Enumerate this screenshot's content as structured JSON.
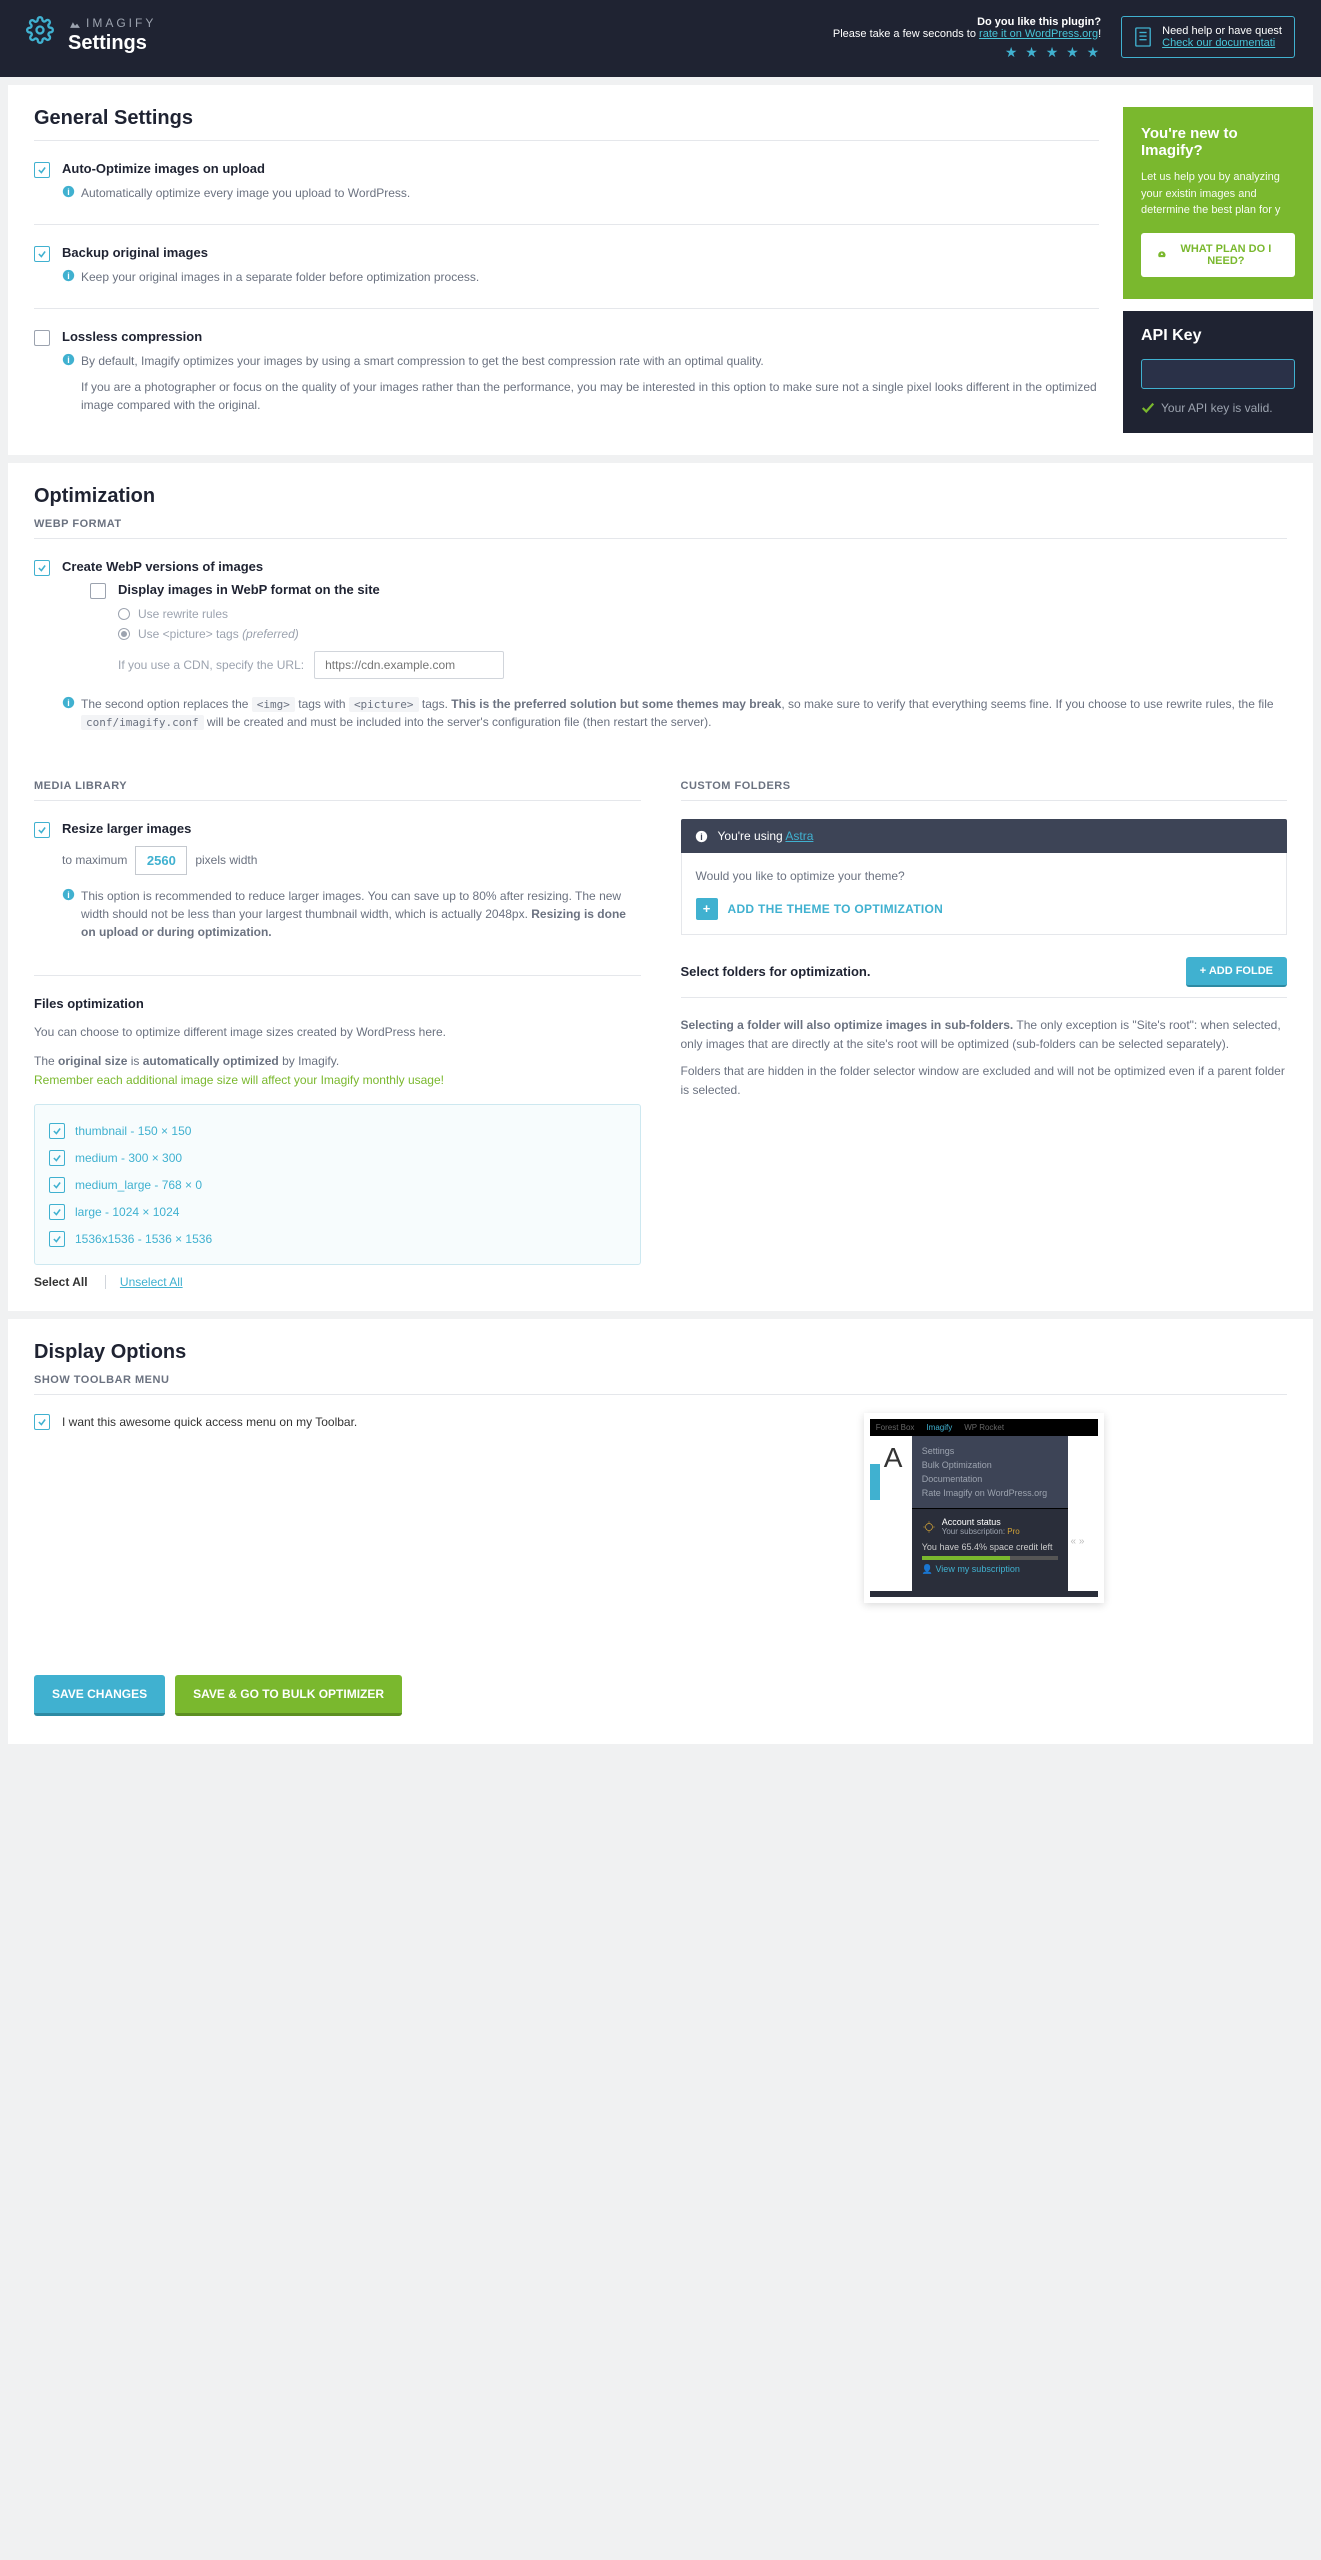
{
  "header": {
    "brand": "IMAGIFY",
    "title": "Settings",
    "rate_q": "Do you like this plugin?",
    "rate_pre": "Please take a few seconds to ",
    "rate_link": "rate it on WordPress.org",
    "help_q": "Need help or have quest",
    "help_link": "Check our documentati"
  },
  "general": {
    "heading": "General Settings",
    "auto": {
      "label": "Auto-Optimize images on upload",
      "desc": "Automatically optimize every image you upload to WordPress."
    },
    "backup": {
      "label": "Backup original images",
      "desc": "Keep your original images in a separate folder before optimization process."
    },
    "lossless": {
      "label": "Lossless compression",
      "desc1": "By default, Imagify optimizes your images by using a smart compression to get the best compression rate with an optimal quality.",
      "desc2": "If you are a photographer or focus on the quality of your images rather than the performance, you may be interested in this option to make sure not a single pixel looks different in the optimized image compared with the original."
    }
  },
  "promo": {
    "title": "You're new to Imagify?",
    "body": "Let us help you by analyzing your existin images and determine the best plan for y",
    "btn": "WHAT PLAN DO I NEED?"
  },
  "api": {
    "title": "API Key",
    "valid": "Your API key is valid."
  },
  "opt": {
    "heading": "Optimization",
    "sub_webp": "WEBP FORMAT",
    "create_webp": "Create WebP versions of images",
    "display_webp": "Display images in WebP format on the site",
    "r1": "Use rewrite rules",
    "r2_a": "Use <picture> tags ",
    "r2_b": "(preferred)",
    "cdn_label": "If you use a CDN, specify the URL:",
    "cdn_ph": "https://cdn.example.com",
    "note1a": "The second option replaces the ",
    "note1b": " tags with ",
    "note1c": " tags. ",
    "note1d": "This is the preferred solution but some themes may break",
    "note1e": ", so make sure to verify that everything seems fine. If you choose to use rewrite rules, the file ",
    "note1f": " will be created and must be included into the server's configuration file (then restart the server).",
    "code_img": "<img>",
    "code_pic": "<picture>",
    "code_conf": "conf/imagify.conf",
    "sub_media": "MEDIA LIBRARY",
    "sub_custom": "CUSTOM FOLDERS",
    "resize_label": "Resize larger images",
    "resize_to": "to maximum",
    "resize_val": "2560",
    "resize_px": "pixels width",
    "resize_note_a": "This option is recommended to reduce larger images. You can save up to 80% after resizing. The new width should not be less than your largest thumbnail width, which is actually 2048px. ",
    "resize_note_b": "Resizing is done on upload or during optimization.",
    "files_head": "Files optimization",
    "files_p1": "You can choose to optimize different image sizes created by WordPress here.",
    "files_p2a": "The ",
    "files_p2b": "original size",
    "files_p2c": " is ",
    "files_p2d": "automatically optimized",
    "files_p2e": " by Imagify.",
    "files_p3": "Remember each additional image size will affect your Imagify monthly usage!",
    "sizes": [
      "thumbnail - 150 × 150",
      "medium - 300 × 300",
      "medium_large - 768 × 0",
      "large - 1024 × 1024",
      "1536x1536 - 1536 × 1536"
    ],
    "select_all": "Select All",
    "unselect_all": "Unselect All",
    "astra_pre": "You're using ",
    "astra": "Astra",
    "theme_q": "Would you like to optimize your theme?",
    "add_theme": "ADD THE THEME TO OPTIMIZATION",
    "folders_head": "Select folders for optimization.",
    "add_folder": "+   ADD FOLDE",
    "fold_p1a": "Selecting a folder will also optimize images in sub-folders.",
    "fold_p1b": " The only exception is \"Site's root\": when selected, only images that are directly at the site's root will be optimized (sub-folders can be selected separately).",
    "fold_p2": "Folders that are hidden in the folder selector window are excluded and will not be optimized even if a parent folder is selected."
  },
  "display": {
    "heading": "Display Options",
    "sub": "SHOW TOOLBAR MENU",
    "label": "I want this awesome quick access menu on my Toolbar.",
    "img": {
      "tab1": "Forest Box",
      "tab2": "Imagify",
      "tab3": "WP Rocket",
      "m1": "Settings",
      "m2": "Bulk Optimization",
      "m3": "Documentation",
      "m4": "Rate Imagify on WordPress.org",
      "acc": "Account status",
      "sub": "Your subscription: ",
      "pro": "Pro",
      "credit": "You have 65.4% space credit left",
      "view": "View my subscription"
    }
  },
  "footer": {
    "save": "SAVE CHANGES",
    "bulk": "SAVE & GO TO BULK OPTIMIZER"
  }
}
